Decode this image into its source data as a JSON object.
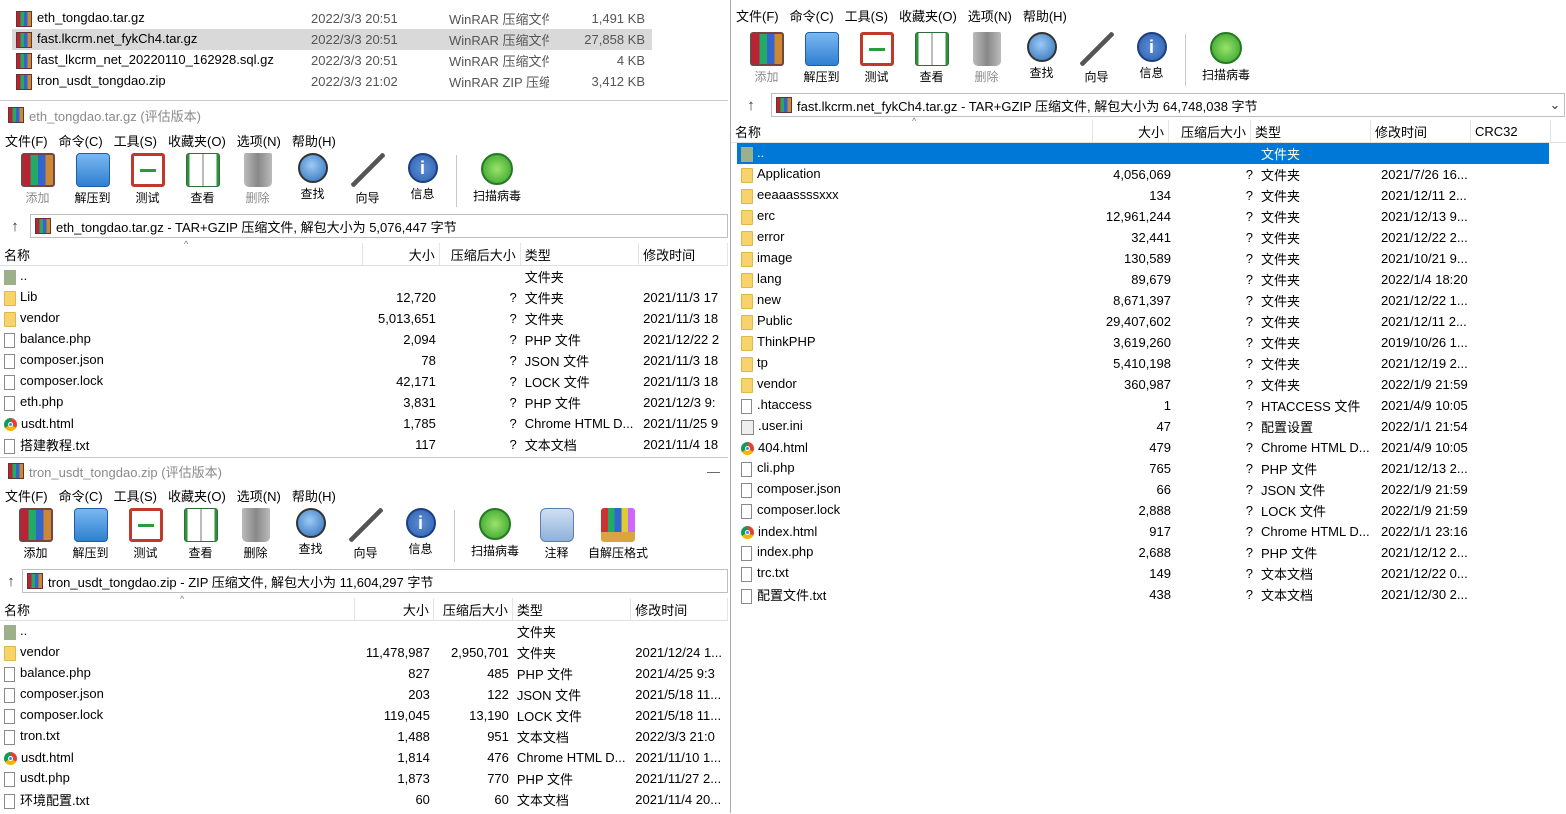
{
  "bg_explorer": {
    "rows": [
      {
        "name": "eth_tongdao.tar.gz",
        "date": "2022/3/3 20:51",
        "type": "WinRAR 压缩文件",
        "size": "1,491 KB",
        "selected": false
      },
      {
        "name": "fast.lkcrm.net_fykCh4.tar.gz",
        "date": "2022/3/3 20:51",
        "type": "WinRAR 压缩文件",
        "size": "27,858 KB",
        "selected": true
      },
      {
        "name": "fast_lkcrm_net_20220110_162928.sql.gz",
        "date": "2022/3/3 20:51",
        "type": "WinRAR 压缩文件",
        "size": "4 KB",
        "selected": false
      },
      {
        "name": "tron_usdt_tongdao.zip",
        "date": "2022/3/3 21:02",
        "type": "WinRAR ZIP 压缩...",
        "size": "3,412 KB",
        "selected": false
      }
    ]
  },
  "win_eth": {
    "title": "eth_tongdao.tar.gz (评估版本)",
    "menu": [
      "文件(F)",
      "命令(C)",
      "工具(S)",
      "收藏夹(O)",
      "选项(N)",
      "帮助(H)"
    ],
    "toolbar": [
      {
        "label": "添加",
        "icon": "add-archive-icon",
        "disabled": true
      },
      {
        "label": "解压到",
        "icon": "extract-folder-icon",
        "disabled": false
      },
      {
        "label": "测试",
        "icon": "test-clipboard-icon",
        "disabled": false
      },
      {
        "label": "查看",
        "icon": "view-book-icon",
        "disabled": false
      },
      {
        "label": "删除",
        "icon": "trash-icon",
        "disabled": true
      },
      {
        "label": "查找",
        "icon": "find-magnifier-icon",
        "disabled": false
      },
      {
        "label": "向导",
        "icon": "wizard-wand-icon",
        "disabled": false
      },
      {
        "label": "信息",
        "icon": "info-icon",
        "disabled": false
      },
      {
        "label": "扫描病毒",
        "icon": "virus-scan-icon",
        "disabled": false
      }
    ],
    "address": "eth_tongdao.tar.gz - TAR+GZIP 压缩文件, 解包大小为 5,076,447 字节",
    "columns": [
      "名称",
      "大小",
      "压缩后大小",
      "类型",
      "修改时间"
    ],
    "rows": [
      {
        "icon": "updir",
        "name": "..",
        "size": "",
        "packed": "",
        "type": "文件夹",
        "modified": ""
      },
      {
        "icon": "folder",
        "name": "Lib",
        "size": "12,720",
        "packed": "?",
        "type": "文件夹",
        "modified": "2021/11/3 17"
      },
      {
        "icon": "folder",
        "name": "vendor",
        "size": "5,013,651",
        "packed": "?",
        "type": "文件夹",
        "modified": "2021/11/3 18"
      },
      {
        "icon": "file",
        "name": "balance.php",
        "size": "2,094",
        "packed": "?",
        "type": "PHP 文件",
        "modified": "2021/12/22 2"
      },
      {
        "icon": "file",
        "name": "composer.json",
        "size": "78",
        "packed": "?",
        "type": "JSON 文件",
        "modified": "2021/11/3 18"
      },
      {
        "icon": "file",
        "name": "composer.lock",
        "size": "42,171",
        "packed": "?",
        "type": "LOCK 文件",
        "modified": "2021/11/3 18"
      },
      {
        "icon": "file",
        "name": "eth.php",
        "size": "3,831",
        "packed": "?",
        "type": "PHP 文件",
        "modified": "2021/12/3 9:"
      },
      {
        "icon": "chrome",
        "name": "usdt.html",
        "size": "1,785",
        "packed": "?",
        "type": "Chrome HTML D...",
        "modified": "2021/11/25 9"
      },
      {
        "icon": "file",
        "name": "搭建教程.txt",
        "size": "117",
        "packed": "?",
        "type": "文本文档",
        "modified": "2021/11/4 18"
      }
    ]
  },
  "win_tron": {
    "title": "tron_usdt_tongdao.zip (评估版本)",
    "menu": [
      "文件(F)",
      "命令(C)",
      "工具(S)",
      "收藏夹(O)",
      "选项(N)",
      "帮助(H)"
    ],
    "toolbar": [
      {
        "label": "添加",
        "icon": "add-archive-icon",
        "disabled": false
      },
      {
        "label": "解压到",
        "icon": "extract-folder-icon",
        "disabled": false
      },
      {
        "label": "测试",
        "icon": "test-clipboard-icon",
        "disabled": false
      },
      {
        "label": "查看",
        "icon": "view-book-icon",
        "disabled": false
      },
      {
        "label": "删除",
        "icon": "trash-icon",
        "disabled": false
      },
      {
        "label": "查找",
        "icon": "find-magnifier-icon",
        "disabled": false
      },
      {
        "label": "向导",
        "icon": "wizard-wand-icon",
        "disabled": false
      },
      {
        "label": "信息",
        "icon": "info-icon",
        "disabled": false
      },
      {
        "label": "扫描病毒",
        "icon": "virus-scan-icon",
        "disabled": false
      },
      {
        "label": "注释",
        "icon": "comment-icon",
        "disabled": false
      },
      {
        "label": "自解压格式",
        "icon": "sfx-box-icon",
        "disabled": false
      }
    ],
    "address": "tron_usdt_tongdao.zip - ZIP 压缩文件, 解包大小为 11,604,297 字节",
    "columns": [
      "名称",
      "大小",
      "压缩后大小",
      "类型",
      "修改时间"
    ],
    "rows": [
      {
        "icon": "updir",
        "name": "..",
        "size": "",
        "packed": "",
        "type": "文件夹",
        "modified": ""
      },
      {
        "icon": "folder",
        "name": "vendor",
        "size": "11,478,987",
        "packed": "2,950,701",
        "type": "文件夹",
        "modified": "2021/12/24 1..."
      },
      {
        "icon": "file",
        "name": "balance.php",
        "size": "827",
        "packed": "485",
        "type": "PHP 文件",
        "modified": "2021/4/25 9:3"
      },
      {
        "icon": "file",
        "name": "composer.json",
        "size": "203",
        "packed": "122",
        "type": "JSON 文件",
        "modified": "2021/5/18 11..."
      },
      {
        "icon": "file",
        "name": "composer.lock",
        "size": "119,045",
        "packed": "13,190",
        "type": "LOCK 文件",
        "modified": "2021/5/18 11..."
      },
      {
        "icon": "file",
        "name": "tron.txt",
        "size": "1,488",
        "packed": "951",
        "type": "文本文档",
        "modified": "2022/3/3 21:0"
      },
      {
        "icon": "chrome",
        "name": "usdt.html",
        "size": "1,814",
        "packed": "476",
        "type": "Chrome HTML D...",
        "modified": "2021/11/10 1..."
      },
      {
        "icon": "file",
        "name": "usdt.php",
        "size": "1,873",
        "packed": "770",
        "type": "PHP 文件",
        "modified": "2021/11/27 2..."
      },
      {
        "icon": "file",
        "name": "环境配置.txt",
        "size": "60",
        "packed": "60",
        "type": "文本文档",
        "modified": "2021/11/4 20..."
      }
    ]
  },
  "win_fast": {
    "menu": [
      "文件(F)",
      "命令(C)",
      "工具(S)",
      "收藏夹(O)",
      "选项(N)",
      "帮助(H)"
    ],
    "toolbar": [
      {
        "label": "添加",
        "icon": "add-archive-icon",
        "disabled": true
      },
      {
        "label": "解压到",
        "icon": "extract-folder-icon",
        "disabled": false
      },
      {
        "label": "测试",
        "icon": "test-clipboard-icon",
        "disabled": false
      },
      {
        "label": "查看",
        "icon": "view-book-icon",
        "disabled": false
      },
      {
        "label": "删除",
        "icon": "trash-icon",
        "disabled": true
      },
      {
        "label": "查找",
        "icon": "find-magnifier-icon",
        "disabled": false
      },
      {
        "label": "向导",
        "icon": "wizard-wand-icon",
        "disabled": false
      },
      {
        "label": "信息",
        "icon": "info-icon",
        "disabled": false
      },
      {
        "label": "扫描病毒",
        "icon": "virus-scan-icon",
        "disabled": false
      }
    ],
    "address": "fast.lkcrm.net_fykCh4.tar.gz - TAR+GZIP 压缩文件, 解包大小为 64,748,038 字节",
    "columns": [
      "名称",
      "大小",
      "压缩后大小",
      "类型",
      "修改时间",
      "CRC32"
    ],
    "rows": [
      {
        "icon": "updir",
        "name": "..",
        "size": "",
        "packed": "",
        "type": "文件夹",
        "modified": "",
        "selected": true
      },
      {
        "icon": "folder",
        "name": "Application",
        "size": "4,056,069",
        "packed": "?",
        "type": "文件夹",
        "modified": "2021/7/26 16..."
      },
      {
        "icon": "folder",
        "name": "eeaaassssxxx",
        "size": "134",
        "packed": "?",
        "type": "文件夹",
        "modified": "2021/12/11 2..."
      },
      {
        "icon": "folder",
        "name": "erc",
        "size": "12,961,244",
        "packed": "?",
        "type": "文件夹",
        "modified": "2021/12/13 9..."
      },
      {
        "icon": "folder",
        "name": "error",
        "size": "32,441",
        "packed": "?",
        "type": "文件夹",
        "modified": "2021/12/22 2..."
      },
      {
        "icon": "folder",
        "name": "image",
        "size": "130,589",
        "packed": "?",
        "type": "文件夹",
        "modified": "2021/10/21 9..."
      },
      {
        "icon": "folder",
        "name": "lang",
        "size": "89,679",
        "packed": "?",
        "type": "文件夹",
        "modified": "2022/1/4 18:20"
      },
      {
        "icon": "folder",
        "name": "new",
        "size": "8,671,397",
        "packed": "?",
        "type": "文件夹",
        "modified": "2021/12/22 1..."
      },
      {
        "icon": "folder",
        "name": "Public",
        "size": "29,407,602",
        "packed": "?",
        "type": "文件夹",
        "modified": "2021/12/11 2..."
      },
      {
        "icon": "folder",
        "name": "ThinkPHP",
        "size": "3,619,260",
        "packed": "?",
        "type": "文件夹",
        "modified": "2019/10/26 1..."
      },
      {
        "icon": "folder",
        "name": "tp",
        "size": "5,410,198",
        "packed": "?",
        "type": "文件夹",
        "modified": "2021/12/19 2..."
      },
      {
        "icon": "folder",
        "name": "vendor",
        "size": "360,987",
        "packed": "?",
        "type": "文件夹",
        "modified": "2022/1/9 21:59"
      },
      {
        "icon": "file",
        "name": ".htaccess",
        "size": "1",
        "packed": "?",
        "type": "HTACCESS 文件",
        "modified": "2021/4/9 10:05"
      },
      {
        "icon": "gear",
        "name": ".user.ini",
        "size": "47",
        "packed": "?",
        "type": "配置设置",
        "modified": "2022/1/1 21:54"
      },
      {
        "icon": "chrome",
        "name": "404.html",
        "size": "479",
        "packed": "?",
        "type": "Chrome HTML D...",
        "modified": "2021/4/9 10:05"
      },
      {
        "icon": "file",
        "name": "cli.php",
        "size": "765",
        "packed": "?",
        "type": "PHP 文件",
        "modified": "2021/12/13 2..."
      },
      {
        "icon": "file",
        "name": "composer.json",
        "size": "66",
        "packed": "?",
        "type": "JSON 文件",
        "modified": "2022/1/9 21:59"
      },
      {
        "icon": "file",
        "name": "composer.lock",
        "size": "2,888",
        "packed": "?",
        "type": "LOCK 文件",
        "modified": "2022/1/9 21:59"
      },
      {
        "icon": "chrome",
        "name": "index.html",
        "size": "917",
        "packed": "?",
        "type": "Chrome HTML D...",
        "modified": "2022/1/1 23:16"
      },
      {
        "icon": "file",
        "name": "index.php",
        "size": "2,688",
        "packed": "?",
        "type": "PHP 文件",
        "modified": "2021/12/12 2..."
      },
      {
        "icon": "file",
        "name": "trc.txt",
        "size": "149",
        "packed": "?",
        "type": "文本文档",
        "modified": "2021/12/22 0..."
      },
      {
        "icon": "file",
        "name": "配置文件.txt",
        "size": "438",
        "packed": "?",
        "type": "文本文档",
        "modified": "2021/12/30 2..."
      }
    ]
  },
  "colors": {
    "selection": "#0078d7",
    "bg_selection": "#d9d9d9",
    "folder": "#f6d46b"
  }
}
